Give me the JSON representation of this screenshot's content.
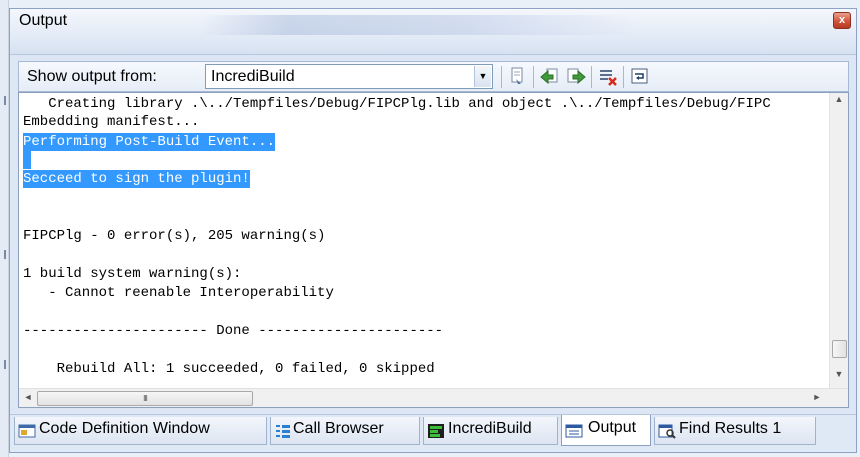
{
  "window": {
    "title": "Output",
    "close_glyph": "x"
  },
  "toolbar": {
    "show_output_label": "Show output from:",
    "source_value": "IncrediBuild",
    "buttons": [
      {
        "name": "find-message-in-code-icon"
      },
      {
        "name": "go-to-previous-message-icon"
      },
      {
        "name": "go-to-next-message-icon"
      },
      {
        "name": "clear-all-icon"
      },
      {
        "name": "toggle-word-wrap-icon"
      }
    ]
  },
  "output": {
    "lines": [
      "   Creating library .\\../Tempfiles/Debug/FIPCPlg.lib and object .\\../Tempfiles/Debug/FIPC",
      "Embedding manifest...",
      "Performing Post-Build Event...",
      " ",
      "Secceed to sign the plugin!",
      "",
      "",
      "FIPCPlg - 0 error(s), 205 warning(s)",
      "",
      "1 build system warning(s):",
      "   - Cannot reenable Interoperability",
      "",
      "---------------------- Done ----------------------",
      "",
      "    Rebuild All: 1 succeeded, 0 failed, 0 skipped"
    ],
    "scroll_thumb_glyph": "III"
  },
  "tabs": [
    {
      "label": "Code Definition Window",
      "icon": "code-definition-icon"
    },
    {
      "label": "Call Browser",
      "icon": "call-browser-icon"
    },
    {
      "label": "IncrediBuild",
      "icon": "incredibuild-icon"
    },
    {
      "label": "Output",
      "icon": "output-icon",
      "active": true
    },
    {
      "label": "Find Results 1",
      "icon": "find-results-icon"
    }
  ],
  "colors": {
    "selection": "#3399ff",
    "close_button": "#c9482f",
    "frame": "#8da2c4"
  }
}
